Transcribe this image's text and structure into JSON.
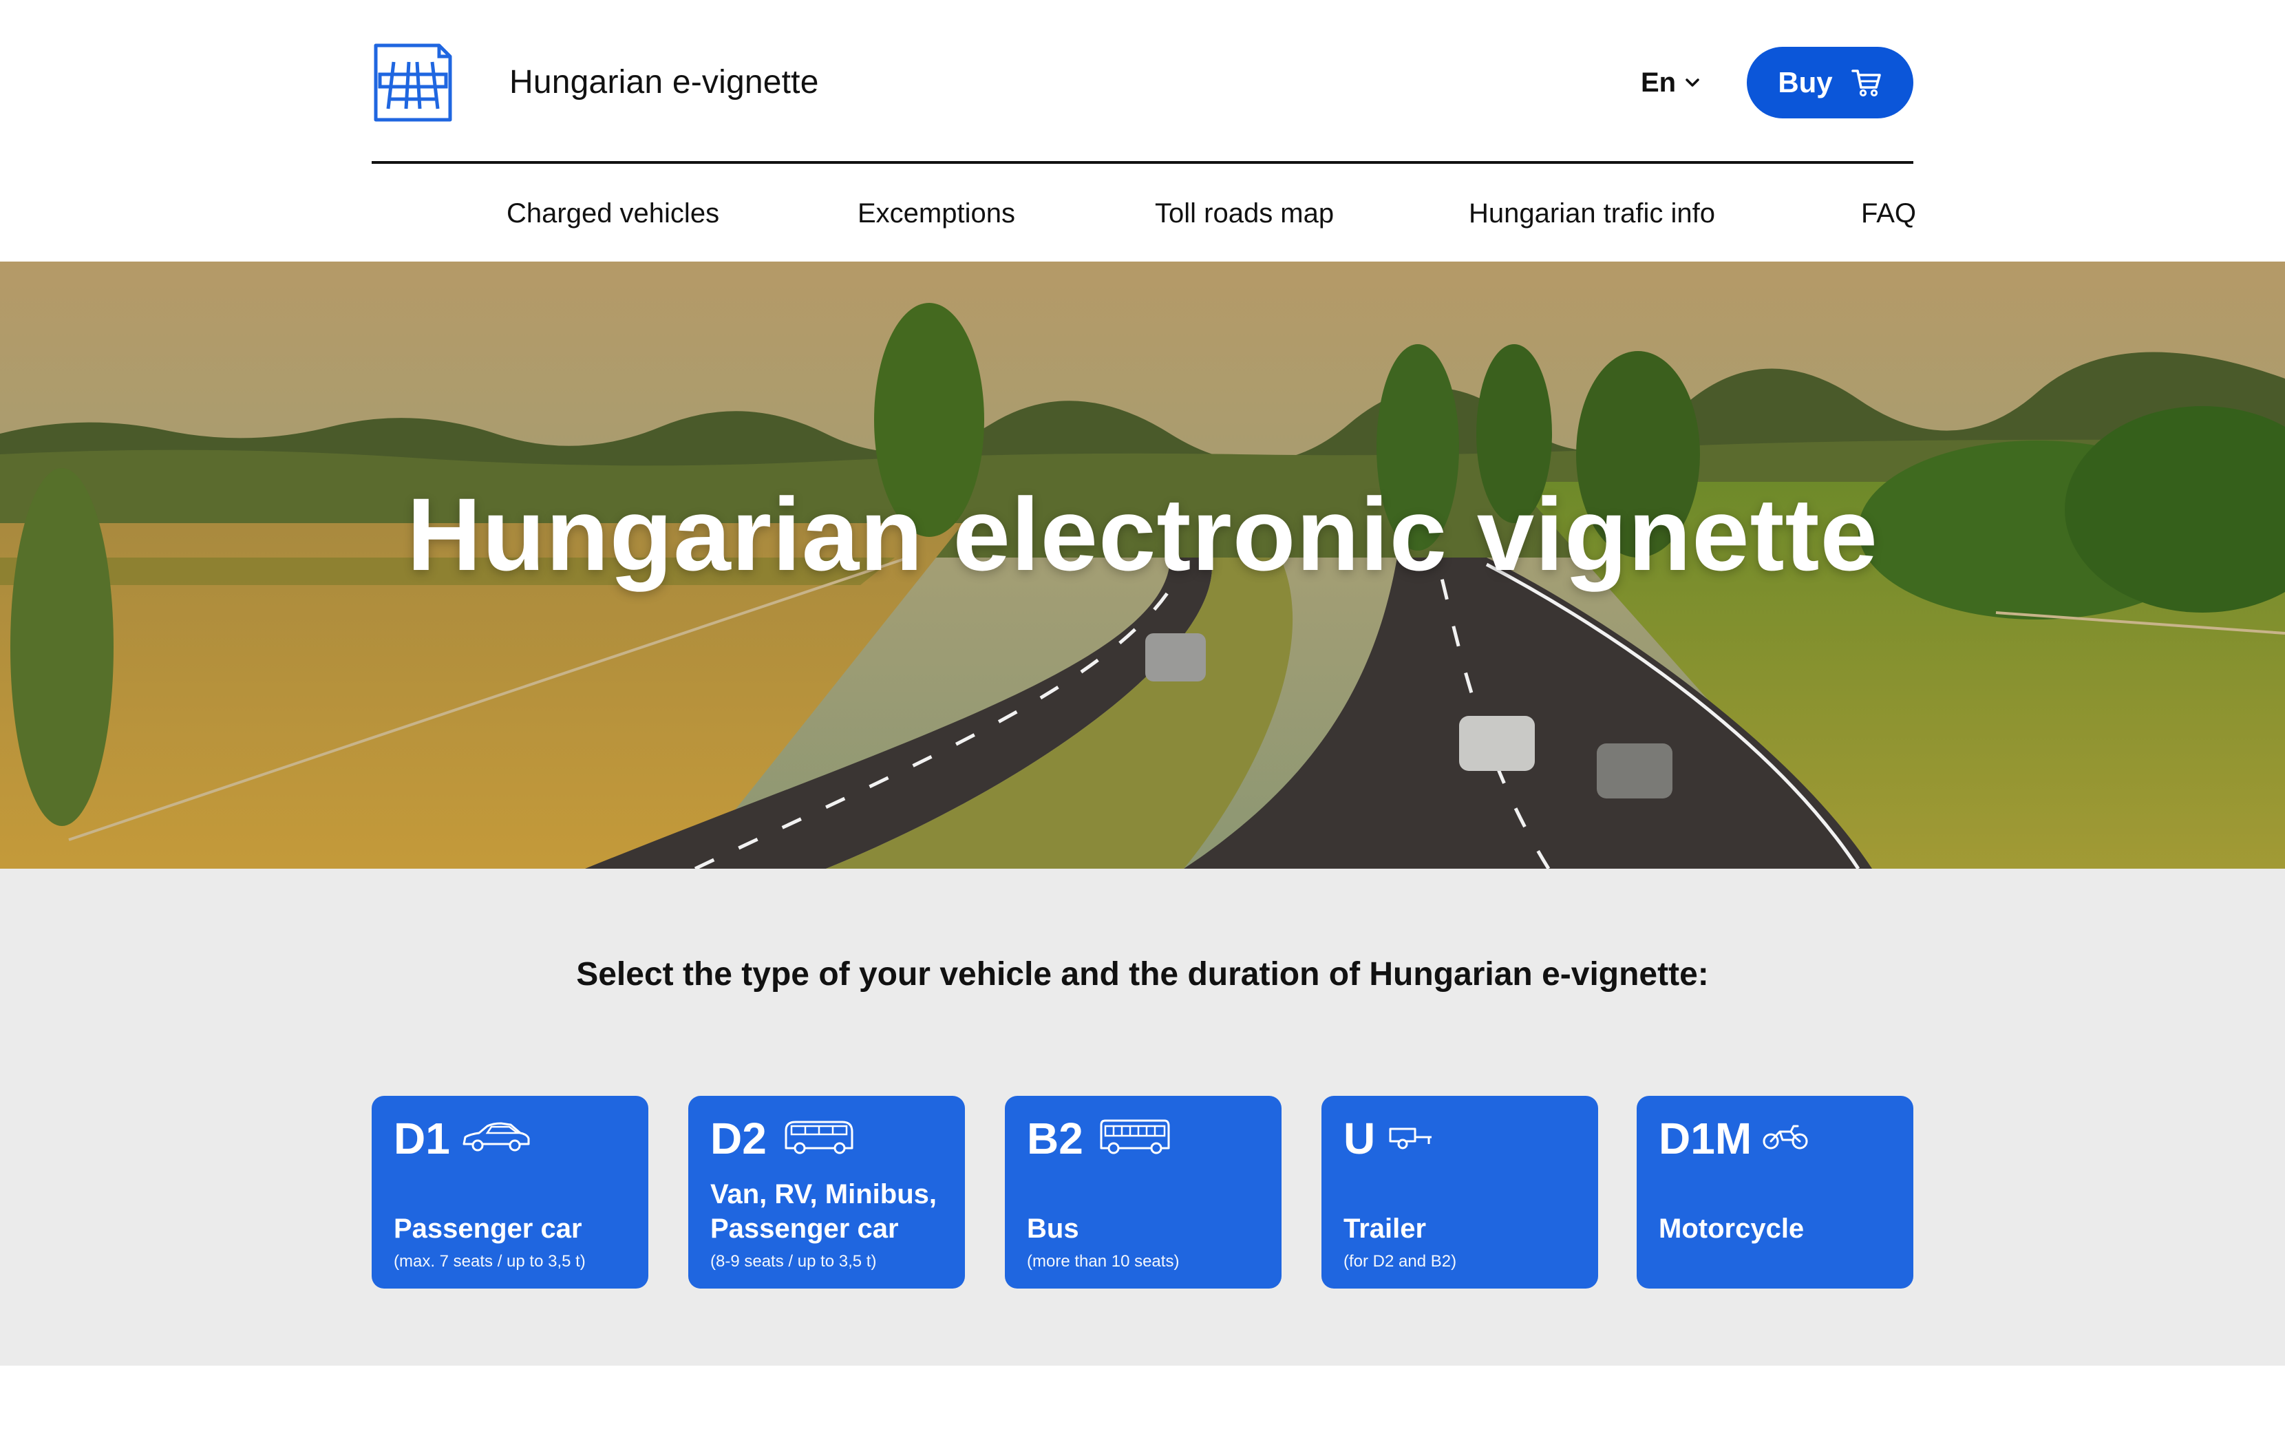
{
  "header": {
    "brand": "Hungarian e-vignette",
    "language": "En",
    "buy_label": "Buy"
  },
  "nav": {
    "items": [
      {
        "label": "Charged vehicles"
      },
      {
        "label": "Excemptions"
      },
      {
        "label": "Toll roads map"
      },
      {
        "label": "Hungarian trafic info"
      },
      {
        "label": "FAQ"
      }
    ]
  },
  "hero": {
    "title": "Hungarian electronic vignette"
  },
  "selection": {
    "title": "Select the type of your vehicle and the duration of Hungarian e-vignette:",
    "cards": [
      {
        "code": "D1",
        "name": "Passenger car",
        "sub": "(max. 7 seats / up to 3,5 t)",
        "icon": "car-icon"
      },
      {
        "code": "D2",
        "name": "Van, RV, Minibus, Passenger car",
        "sub": "(8-9 seats / up to 3,5 t)",
        "icon": "van-icon"
      },
      {
        "code": "B2",
        "name": "Bus",
        "sub": "(more than 10 seats)",
        "icon": "bus-icon"
      },
      {
        "code": "U",
        "name": "Trailer",
        "sub": "(for D2 and B2)",
        "icon": "trailer-icon"
      },
      {
        "code": "D1M",
        "name": "Motorcycle",
        "sub": "",
        "icon": "motorcycle-icon"
      }
    ]
  },
  "colors": {
    "primary": "#0b56d9",
    "card": "#1f66e0",
    "section_bg": "#ebebeb"
  }
}
